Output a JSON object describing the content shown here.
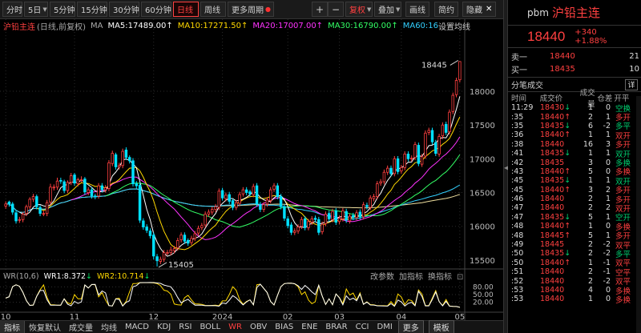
{
  "toolbar": {
    "items": [
      {
        "label": "分时",
        "w": 25
      },
      {
        "label": "5日",
        "w": 30,
        "tri": true
      },
      {
        "label": "5分钟",
        "w": 32
      },
      {
        "label": "15分钟",
        "w": 38
      },
      {
        "label": "30分钟",
        "w": 38
      },
      {
        "label": "60分钟",
        "w": 38
      },
      {
        "label": "日线",
        "w": 32,
        "active": true
      },
      {
        "label": "周线",
        "w": 32
      },
      {
        "label": "更多周期",
        "w": 58,
        "dot": true
      }
    ],
    "plus": "+",
    "minus": "−",
    "adjust": "复权",
    "overlay": "叠加",
    "draw_line": "画线",
    "simple": "简约",
    "hide": "隐藏",
    "close_symbol": "✕"
  },
  "legend": {
    "symbol": "沪铅主连",
    "sub": "(日线,前复权)",
    "ma_label": "MA",
    "ma5": "MA5:17489.00↑",
    "ma10": "MA10:17271.50↑",
    "ma20": "MA20:17007.00↑",
    "ma30": "MA30:16790.00↑",
    "ma60": "MA60:16",
    "ma_setting": "设置均线"
  },
  "colors": {
    "ma5": "#ffffff",
    "ma10": "#ffd800",
    "ma20": "#ff33ff",
    "ma30": "#33ff66",
    "ma60": "#33d0ff",
    "ma120": "#f0e0a0",
    "up": "#ff4040",
    "down": "#00e0ff",
    "wr1": "#ffffff",
    "wr2": "#ffd800"
  },
  "wr": {
    "label": "WR(10,6)",
    "wr1": "WR1:8.372",
    "wr1_arrow": "↓",
    "wr2": "WR2:10.714",
    "wr2_arrow": "↓"
  },
  "mid_links": [
    "改参数",
    "加指标",
    "换指标"
  ],
  "bottom": {
    "indicator_btn": "指标",
    "tabs": [
      "恢复默认",
      "成交量",
      "均线",
      "MACD",
      "KDJ",
      "RSI",
      "BOLL",
      "WR",
      "OBV",
      "BIAS",
      "ENE",
      "BRAR",
      "CCI",
      "DMI",
      "更多"
    ],
    "active": "WR",
    "template": "模板"
  },
  "chart_data": {
    "type": "candlestick",
    "y_ticks": [
      18000,
      17500,
      17000,
      16500,
      16000,
      15500
    ],
    "y_range": [
      15380,
      18640
    ],
    "wr_ticks": [
      "80.00",
      "50.00",
      "20.00"
    ],
    "x_ticks": [
      {
        "label": "10",
        "i": 0
      },
      {
        "label": "11",
        "i": 20
      },
      {
        "label": "12",
        "i": 43
      },
      {
        "label": "2024",
        "i": 63
      },
      {
        "label": "02",
        "i": 82
      },
      {
        "label": "03",
        "i": 97
      },
      {
        "label": "04",
        "i": 115
      },
      {
        "label": "05",
        "i": 132
      }
    ],
    "high_label": "18445",
    "low_label": "15405",
    "close": [
      16330,
      16330,
      16210,
      16080,
      16100,
      16180,
      16290,
      16400,
      16440,
      16290,
      16190,
      16190,
      16350,
      16580,
      16580,
      16670,
      16670,
      16530,
      16650,
      16750,
      16640,
      16690,
      16690,
      16510,
      16540,
      16450,
      16440,
      16600,
      16540,
      16570,
      16940,
      17080,
      16880,
      16900,
      17110,
      17020,
      16970,
      16630,
      16600,
      16090,
      15990,
      15940,
      15860,
      15560,
      15490,
      15510,
      15610,
      15610,
      15650,
      15670,
      15790,
      15870,
      15780,
      15750,
      15820,
      15890,
      15970,
      16010,
      16180,
      16210,
      16250,
      16290,
      16520,
      16420,
      16460,
      16370,
      16280,
      16350,
      16470,
      16540,
      16500,
      16480,
      16590,
      16330,
      16250,
      16320,
      16390,
      16540,
      16600,
      16440,
      16290,
      16120,
      16010,
      15910,
      15930,
      15990,
      16100,
      15980,
      16070,
      16110,
      16100,
      15910,
      16030,
      16180,
      16110,
      16220,
      16060,
      16120,
      16230,
      16090,
      16150,
      16130,
      16200,
      16140,
      16320,
      16290,
      16420,
      16440,
      16630,
      16660,
      16800,
      16860,
      16780,
      17000,
      16810,
      16870,
      17070,
      17000,
      17010,
      17210,
      16930,
      17030,
      17380,
      17420,
      17250,
      17080,
      17330,
      17500,
      17390,
      17690,
      17940,
      18160,
      18440
    ],
    "open": [
      16300,
      16360,
      16330,
      16200,
      16090,
      16100,
      16190,
      16290,
      16400,
      16440,
      16280,
      16190,
      16190,
      16360,
      16570,
      16580,
      16680,
      16660,
      16530,
      16650,
      16760,
      16630,
      16690,
      16700,
      16500,
      16540,
      16450,
      16450,
      16600,
      16540,
      16560,
      16930,
      17060,
      16880,
      16900,
      17130,
      17020,
      16970,
      16630,
      16610,
      16080,
      15990,
      15930,
      15870,
      15550,
      15480,
      15510,
      15610,
      15610,
      15640,
      15680,
      15800,
      15870,
      15790,
      15760,
      15820,
      15900,
      15980,
      16020,
      16180,
      16210,
      16250,
      16280,
      16530,
      16410,
      16470,
      16380,
      16280,
      16340,
      16480,
      16540,
      16510,
      16470,
      16600,
      16320,
      16250,
      16330,
      16380,
      16550,
      16600,
      16440,
      16290,
      16110,
      16020,
      15910,
      15930,
      16000,
      16110,
      15980,
      16060,
      16120,
      16100,
      15920,
      16040,
      16190,
      16100,
      16230,
      16070,
      16110,
      16220,
      16080,
      16160,
      16130,
      16210,
      16140,
      16310,
      16280,
      16410,
      16440,
      16640,
      16660,
      16800,
      16860,
      16780,
      17000,
      16820,
      16870,
      17070,
      17010,
      17020,
      17200,
      16920,
      17040,
      17390,
      17420,
      17240,
      17070,
      17340,
      17510,
      17400,
      17700,
      17950,
      18170
    ],
    "high": [
      16370,
      16380,
      16360,
      16240,
      16140,
      16210,
      16320,
      16430,
      16480,
      16470,
      16310,
      16230,
      16390,
      16630,
      16620,
      16720,
      16720,
      16690,
      16680,
      16790,
      16790,
      16720,
      16740,
      16730,
      16580,
      16580,
      16480,
      16640,
      16640,
      16610,
      16980,
      17120,
      17090,
      16940,
      17150,
      17170,
      17050,
      17010,
      16670,
      16650,
      16120,
      16030,
      15970,
      15910,
      15590,
      15550,
      15650,
      15650,
      15700,
      15710,
      15830,
      15910,
      15910,
      15820,
      15860,
      15930,
      16010,
      16050,
      16220,
      16250,
      16290,
      16330,
      16560,
      16570,
      16500,
      16510,
      16410,
      16390,
      16510,
      16580,
      16580,
      16540,
      16630,
      16640,
      16360,
      16360,
      16430,
      16580,
      16640,
      16640,
      16480,
      16330,
      16150,
      16060,
      15970,
      16030,
      16140,
      16150,
      16110,
      16150,
      16160,
      16140,
      16070,
      16220,
      16230,
      16260,
      16270,
      16160,
      16270,
      16260,
      16190,
      16200,
      16240,
      16250,
      16360,
      16350,
      16460,
      16480,
      16670,
      16700,
      16840,
      16900,
      16900,
      17040,
      17040,
      16910,
      17110,
      17110,
      17050,
      17250,
      17240,
      17070,
      17420,
      17460,
      17460,
      17280,
      17370,
      17540,
      17550,
      17730,
      17980,
      18200,
      18445
    ],
    "low": [
      16260,
      16290,
      16170,
      16040,
      16050,
      16060,
      16150,
      16250,
      16360,
      16250,
      16150,
      16150,
      16150,
      16320,
      16530,
      16540,
      16630,
      16490,
      16490,
      16610,
      16600,
      16590,
      16650,
      16470,
      16460,
      16410,
      16400,
      16410,
      16500,
      16500,
      16520,
      16890,
      16840,
      16840,
      16860,
      16980,
      16930,
      16590,
      16560,
      16050,
      15950,
      15900,
      15820,
      15510,
      15405,
      15440,
      15470,
      15570,
      15570,
      15600,
      15640,
      15760,
      15740,
      15710,
      15720,
      15780,
      15860,
      15940,
      15980,
      16140,
      16170,
      16210,
      16240,
      16380,
      16370,
      16330,
      16240,
      16240,
      16300,
      16440,
      16460,
      16440,
      16430,
      16290,
      16210,
      16210,
      16290,
      16340,
      16510,
      16400,
      16250,
      16080,
      15970,
      15870,
      15870,
      15890,
      15960,
      15940,
      15940,
      16020,
      16060,
      15870,
      15880,
      16000,
      16070,
      16060,
      16020,
      16030,
      16070,
      16050,
      16040,
      16090,
      16090,
      16100,
      16100,
      16250,
      16240,
      16370,
      16400,
      16600,
      16620,
      16760,
      16740,
      16740,
      16770,
      16780,
      16830,
      16960,
      16960,
      16980,
      16890,
      16880,
      17000,
      17350,
      17210,
      17040,
      17030,
      17290,
      17350,
      17360,
      17660,
      17910,
      18130
    ]
  },
  "quote": {
    "code": "pbm",
    "name": "沪铅主连",
    "price": "18440",
    "chg": "+340",
    "pct": "+1.88%"
  },
  "bidask": [
    {
      "label": "卖一",
      "price": "18440",
      "vol": "21"
    },
    {
      "label": "买一",
      "price": "18435",
      "vol": "10"
    }
  ],
  "ticks_head": {
    "title": "分笔成交",
    "detail": "详"
  },
  "tick_cols": {
    "time": "时间",
    "price": "成交价",
    "vol": "成交量",
    "oi": "仓差",
    "type": "开平"
  },
  "ticks": [
    {
      "t": "11:29",
      "p": "18430",
      "d": "dn",
      "v": "1",
      "oi": "0",
      "ty": "空换",
      "tc": "dn"
    },
    {
      "t": ":35",
      "p": "18440",
      "d": "up",
      "v": "2",
      "oi": "1",
      "ty": "多开",
      "tc": "up"
    },
    {
      "t": ":35",
      "p": "18435",
      "d": "dn",
      "v": "6",
      "oi": "-2",
      "ty": "多平",
      "tc": "dn"
    },
    {
      "t": ":36",
      "p": "18440",
      "d": "up",
      "v": "1",
      "oi": "1",
      "ty": "双开",
      "tc": "up"
    },
    {
      "t": ":38",
      "p": "18440",
      "d": "",
      "v": "16",
      "oi": "3",
      "ty": "多开",
      "tc": "up"
    },
    {
      "t": ":41",
      "p": "18435",
      "d": "dn",
      "v": "1",
      "oi": "1",
      "ty": "双开",
      "tc": "dn"
    },
    {
      "t": ":42",
      "p": "18435",
      "d": "",
      "v": "3",
      "oi": "0",
      "ty": "多换",
      "tc": "dn"
    },
    {
      "t": ":43",
      "p": "18440",
      "d": "up",
      "v": "5",
      "oi": "0",
      "ty": "多换",
      "tc": "up"
    },
    {
      "t": ":45",
      "p": "18435",
      "d": "dn",
      "v": "1",
      "oi": "1",
      "ty": "双开",
      "tc": "dn"
    },
    {
      "t": ":45",
      "p": "18440",
      "d": "up",
      "v": "3",
      "oi": "2",
      "ty": "多开",
      "tc": "up"
    },
    {
      "t": ":46",
      "p": "18440",
      "d": "",
      "v": "2",
      "oi": "1",
      "ty": "多开",
      "tc": "up"
    },
    {
      "t": ":47",
      "p": "18440",
      "d": "",
      "v": "2",
      "oi": "2",
      "ty": "双开",
      "tc": "up"
    },
    {
      "t": ":47",
      "p": "18435",
      "d": "dn",
      "v": "5",
      "oi": "1",
      "ty": "空开",
      "tc": "dn"
    },
    {
      "t": ":48",
      "p": "18440",
      "d": "up",
      "v": "1",
      "oi": "0",
      "ty": "多换",
      "tc": "up"
    },
    {
      "t": ":48",
      "p": "18445",
      "d": "up",
      "v": "5",
      "oi": "1",
      "ty": "多开",
      "tc": "up"
    },
    {
      "t": ":49",
      "p": "18445",
      "d": "",
      "v": "2",
      "oi": "-2",
      "ty": "双平",
      "tc": "up"
    },
    {
      "t": ":50",
      "p": "18435",
      "d": "dn",
      "v": "2",
      "oi": "-2",
      "ty": "多平",
      "tc": "dn"
    },
    {
      "t": ":50",
      "p": "18440",
      "d": "up",
      "v": "1",
      "oi": "-1",
      "ty": "双平",
      "tc": "up"
    },
    {
      "t": ":51",
      "p": "18440",
      "d": "",
      "v": "2",
      "oi": "-1",
      "ty": "空平",
      "tc": "up"
    },
    {
      "t": ":52",
      "p": "18440",
      "d": "",
      "v": "2",
      "oi": "-2",
      "ty": "双平",
      "tc": "up"
    },
    {
      "t": ":53",
      "p": "18440",
      "d": "",
      "v": "4",
      "oi": "0",
      "ty": "多换",
      "tc": "up"
    },
    {
      "t": ":53",
      "p": "18440",
      "d": "",
      "v": "1",
      "oi": "0",
      "ty": "多换",
      "tc": "up"
    }
  ]
}
